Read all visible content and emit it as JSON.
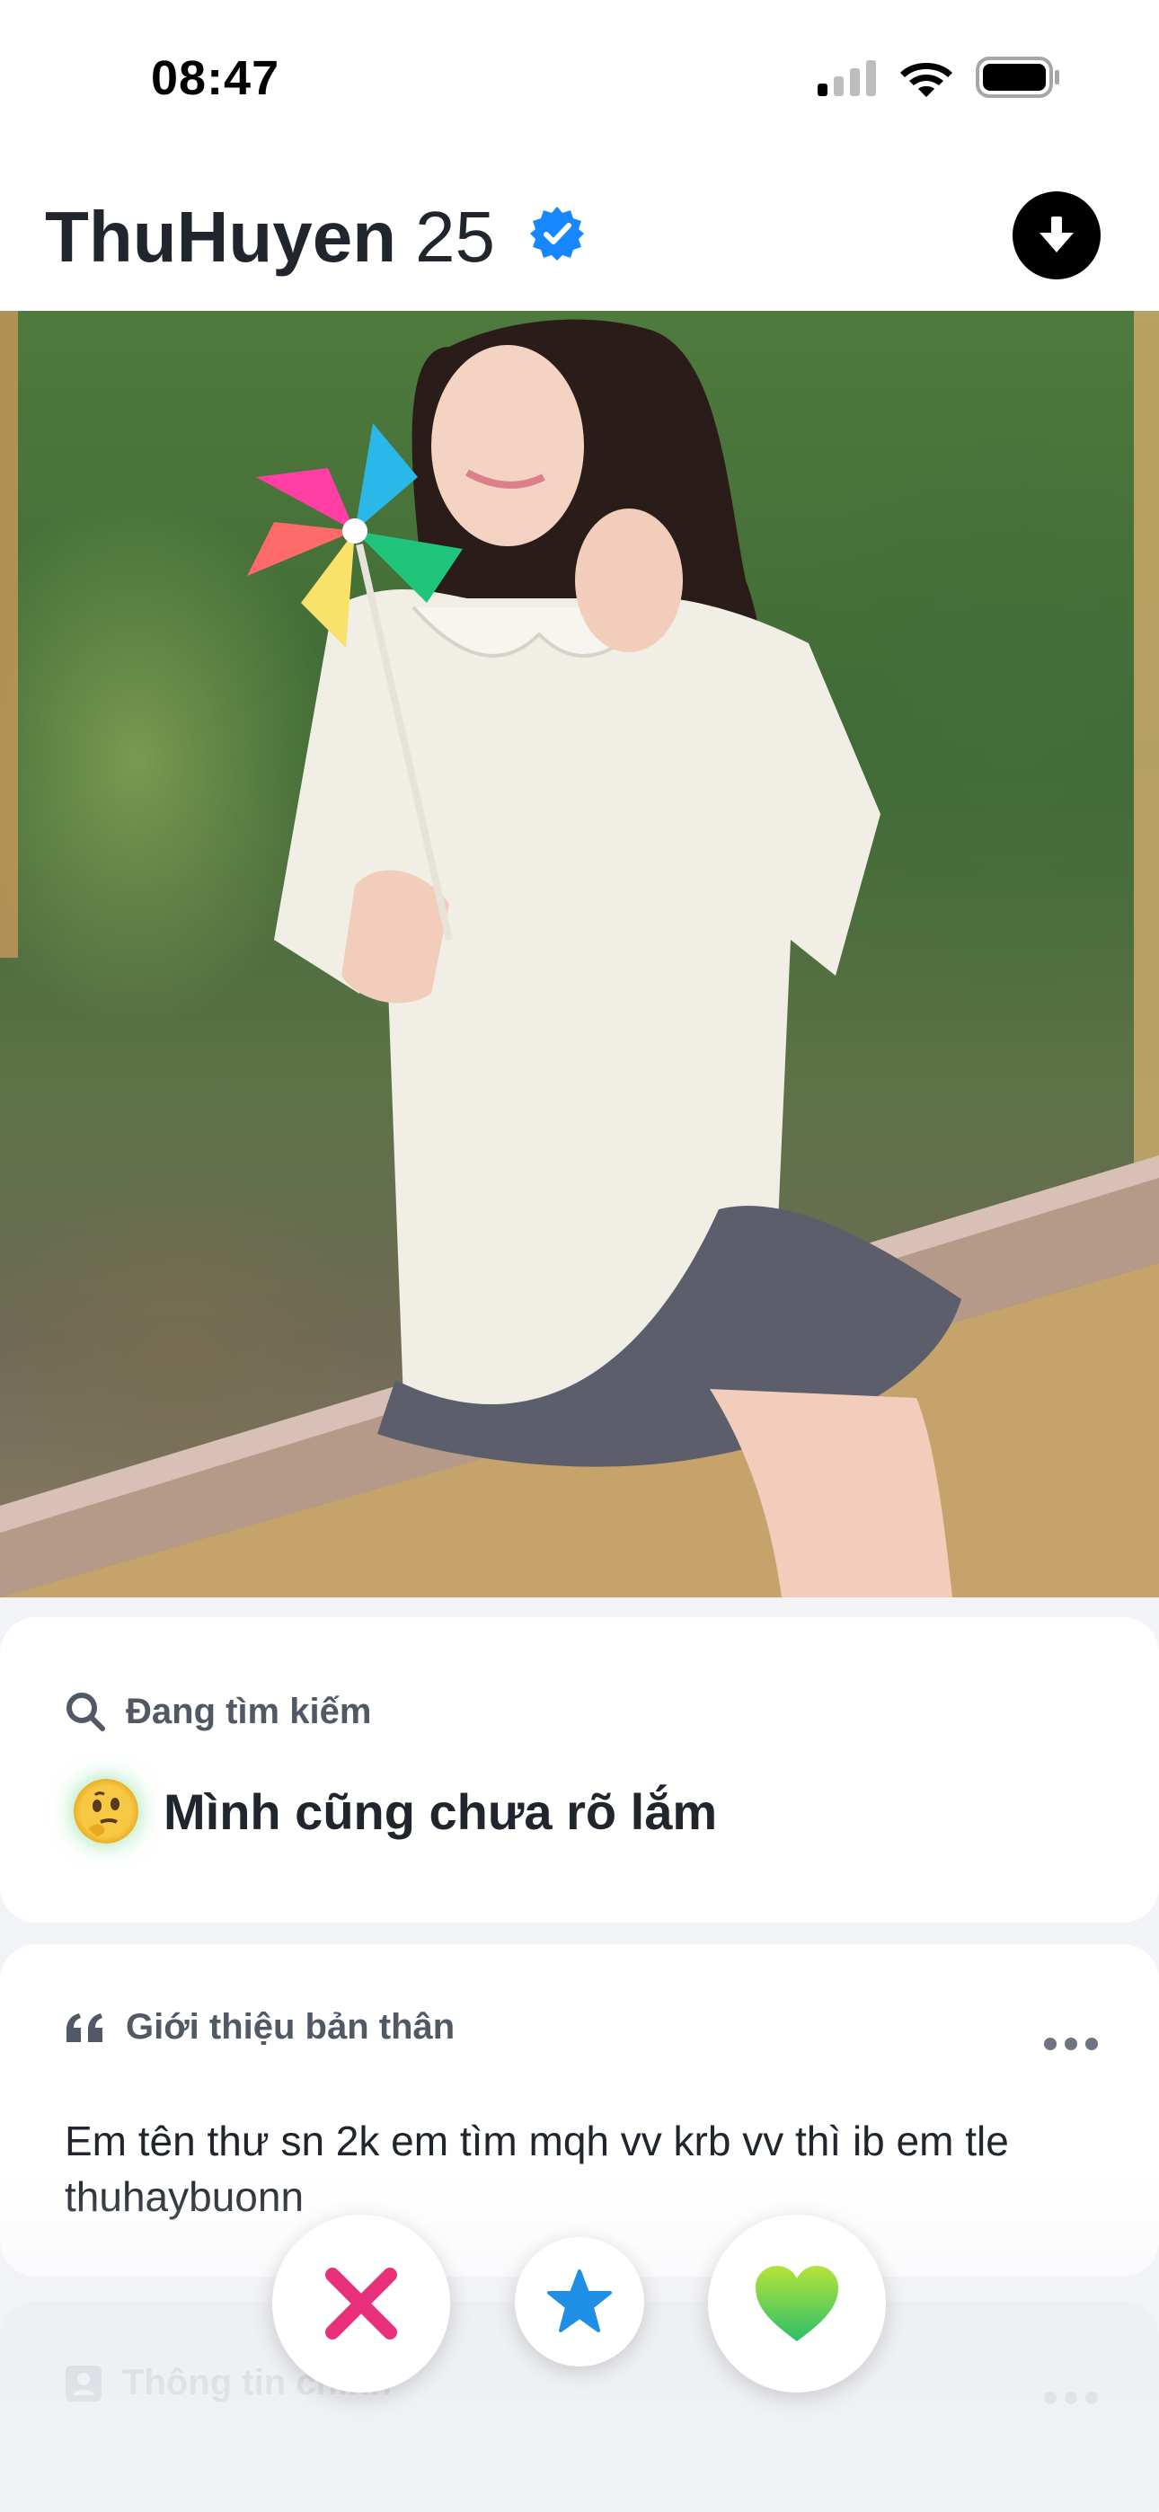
{
  "status_bar": {
    "time": "08:47",
    "icons": [
      "cellular-signal-icon",
      "wifi-icon",
      "battery-icon"
    ]
  },
  "profile": {
    "name": "ThuHuyen",
    "age": "25",
    "verified": true,
    "header_icons": [
      "verified-badge-icon",
      "download-arrow-icon"
    ]
  },
  "looking_for": {
    "header": "Đang tìm kiếm",
    "icon": "search-icon",
    "emoji": "thinking-face-icon",
    "value": "Mình cũng chưa rõ lắm"
  },
  "about": {
    "header": "Giới thiệu bản thân",
    "icon": "quote-icon",
    "text": "Em tên thư sn 2k em tìm mqh vv krb vv thì ib em tle thuhaybuonn"
  },
  "basics": {
    "header": "Thông tin chính",
    "icon": "id-card-icon"
  },
  "actions": [
    "nope-x-icon",
    "super-like-star-icon",
    "like-heart-icon"
  ],
  "colors": {
    "verified": "#1786ff",
    "nope": "#e9307a",
    "superlike": "#1f8fe6",
    "like": "#6ccf3a"
  }
}
